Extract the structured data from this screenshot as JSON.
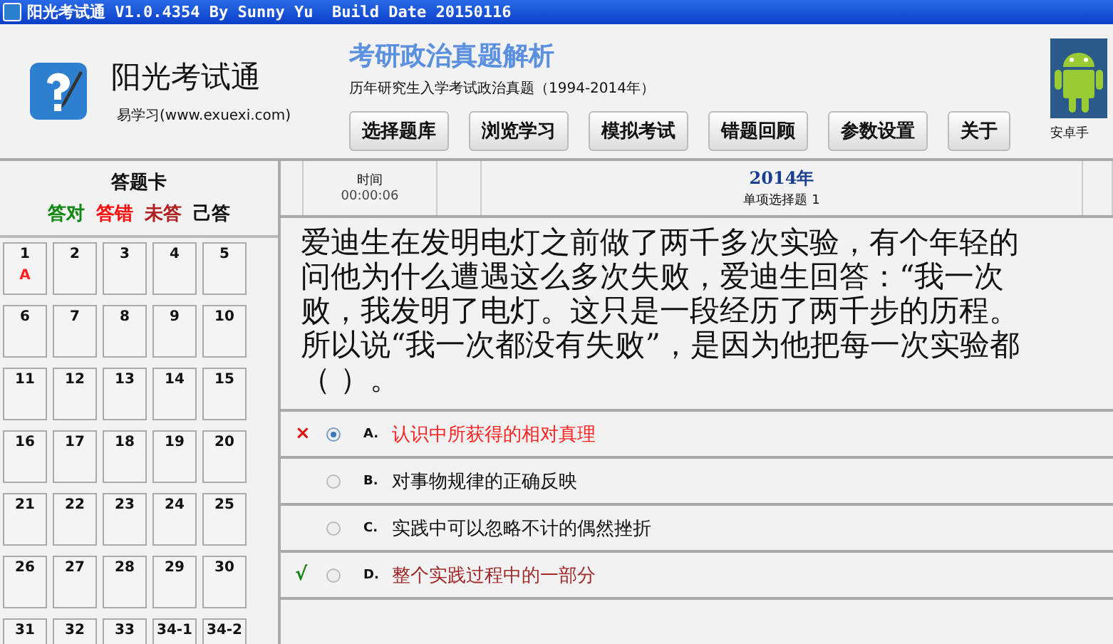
{
  "window": {
    "title": "阳光考试通 V1.0.4354 By Sunny Yu  Build Date 20150116"
  },
  "header": {
    "app_name": "阳光考试通",
    "app_subtitle": "易学习(www.exuexi.com)",
    "course_title": "考研政治真题解析",
    "course_subtitle": "历年研究生入学考试政治真题（1994-2014年）",
    "android_label": "安卓手"
  },
  "toolbar": {
    "buttons": [
      "选择题库",
      "浏览学习",
      "模拟考试",
      "错题回顾",
      "参数设置",
      "关于"
    ]
  },
  "answer_card": {
    "title": "答题卡",
    "legend": [
      {
        "label": "答对",
        "color": "#118811"
      },
      {
        "label": "答错",
        "color": "#ff1010"
      },
      {
        "label": "未答",
        "color": "#b02020"
      },
      {
        "label": "己答",
        "color": "#111111"
      }
    ],
    "cells": [
      {
        "number": "1",
        "answer": "A"
      },
      {
        "number": "2"
      },
      {
        "number": "3"
      },
      {
        "number": "4"
      },
      {
        "number": "5"
      },
      {
        "number": "6"
      },
      {
        "number": "7"
      },
      {
        "number": "8"
      },
      {
        "number": "9"
      },
      {
        "number": "10"
      },
      {
        "number": "11"
      },
      {
        "number": "12"
      },
      {
        "number": "13"
      },
      {
        "number": "14"
      },
      {
        "number": "15"
      },
      {
        "number": "16"
      },
      {
        "number": "17"
      },
      {
        "number": "18"
      },
      {
        "number": "19"
      },
      {
        "number": "20"
      },
      {
        "number": "21"
      },
      {
        "number": "22"
      },
      {
        "number": "23"
      },
      {
        "number": "24"
      },
      {
        "number": "25"
      },
      {
        "number": "26"
      },
      {
        "number": "27"
      },
      {
        "number": "28"
      },
      {
        "number": "29"
      },
      {
        "number": "30"
      },
      {
        "number": "31"
      },
      {
        "number": "32"
      },
      {
        "number": "33"
      },
      {
        "number": "34-1"
      },
      {
        "number": "34-2"
      }
    ]
  },
  "question": {
    "time_label": "时间",
    "time_value": "00:00:06",
    "year": "2014年",
    "section": "单项选择题 1",
    "text_lines": [
      "爱迪生在发明电灯之前做了两千多次实验，有个年轻的",
      "问他为什么遭遇这么多次失败，爱迪生回答：“我一次",
      "败，我发明了电灯。这只是一段经历了两千步的历程。",
      "所以说“我一次都没有失败”，是因为他把每一次实验都",
      "（ ）。"
    ],
    "options": [
      {
        "letter": "A.",
        "text": "认识中所获得的相对真理",
        "selected": true,
        "wrong": true,
        "correct": false,
        "mark": "×"
      },
      {
        "letter": "B.",
        "text": "对事物规律的正确反映",
        "selected": false,
        "wrong": false,
        "correct": false
      },
      {
        "letter": "C.",
        "text": "实践中可以忽略不计的偶然挫折",
        "selected": false,
        "wrong": false,
        "correct": false
      },
      {
        "letter": "D.",
        "text": "整个实践过程中的一部分",
        "selected": false,
        "wrong": false,
        "correct": true,
        "mark": "√"
      }
    ]
  }
}
